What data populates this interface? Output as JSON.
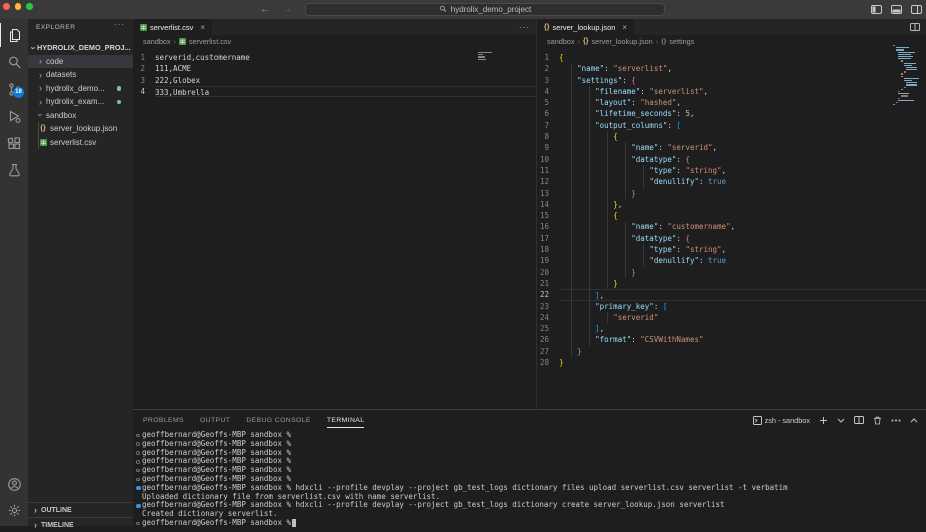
{
  "titlebar": {
    "title": "hydrolix_demo_project",
    "back": "←",
    "forward": "→"
  },
  "activity_bar": {
    "items": [
      {
        "name": "explorer",
        "active": true
      },
      {
        "name": "search"
      },
      {
        "name": "source-control",
        "badge": "18"
      },
      {
        "name": "run-and-debug"
      },
      {
        "name": "extensions"
      },
      {
        "name": "testing"
      }
    ],
    "bottom": [
      {
        "name": "accounts"
      },
      {
        "name": "settings"
      }
    ]
  },
  "sidebar": {
    "title": "EXPLORER",
    "actions_label": "···",
    "root": {
      "label": "HYDROLIX_DEMO_PROJ...",
      "expanded": true
    },
    "items": [
      {
        "label": "code",
        "kind": "folder",
        "selected": true
      },
      {
        "label": "datasets",
        "kind": "folder"
      },
      {
        "label": "hydrolix_demo...",
        "kind": "folder",
        "dot": true
      },
      {
        "label": "hydrolix_exam...",
        "kind": "folder",
        "dot": true
      },
      {
        "label": "sandbox",
        "kind": "folder",
        "expanded": true
      },
      {
        "label": "server_lookup.json",
        "kind": "json",
        "child": true
      },
      {
        "label": "serverlist.csv",
        "kind": "csv",
        "child": true
      }
    ],
    "bottom_sections": [
      {
        "label": "OUTLINE"
      },
      {
        "label": "TIMELINE"
      }
    ]
  },
  "editors": {
    "left": {
      "tab": {
        "label": "serverlist.csv",
        "close": "×"
      },
      "actions_label": "···",
      "breadcrumb": {
        "parts": [
          "sandbox",
          "serverlist.csv"
        ]
      },
      "active_line": 4,
      "lines": [
        {
          "n": 1,
          "tokens": [
            [
              "serverid,customername",
              "t"
            ]
          ]
        },
        {
          "n": 2,
          "tokens": [
            [
              "111,ACME",
              "t"
            ]
          ]
        },
        {
          "n": 3,
          "tokens": [
            [
              "222,Globex",
              "t"
            ]
          ]
        },
        {
          "n": 4,
          "tokens": [
            [
              "333,Umbrella",
              "t"
            ]
          ]
        }
      ]
    },
    "right": {
      "tab": {
        "label": "server_lookup.json",
        "close": "×"
      },
      "breadcrumb": {
        "parts": [
          "sandbox",
          "server_lookup.json",
          "settings"
        ]
      },
      "active_line": 22,
      "lines": [
        {
          "n": 1,
          "tokens": [
            [
              "{",
              "g"
            ]
          ]
        },
        {
          "n": 2,
          "tokens": [
            [
              "    ",
              "w"
            ],
            [
              "\"name\"",
              "k"
            ],
            [
              ": ",
              "p"
            ],
            [
              "\"serverlist\"",
              "s"
            ],
            [
              ",",
              "p"
            ]
          ]
        },
        {
          "n": 3,
          "tokens": [
            [
              "    ",
              "w"
            ],
            [
              "\"settings\"",
              "k"
            ],
            [
              ": ",
              "p"
            ],
            [
              "{",
              "o"
            ]
          ]
        },
        {
          "n": 4,
          "tokens": [
            [
              "        ",
              "w"
            ],
            [
              "\"filename\"",
              "k"
            ],
            [
              ": ",
              "p"
            ],
            [
              "\"serverlist\"",
              "s"
            ],
            [
              ",",
              "p"
            ]
          ]
        },
        {
          "n": 5,
          "tokens": [
            [
              "        ",
              "w"
            ],
            [
              "\"layout\"",
              "k"
            ],
            [
              ": ",
              "p"
            ],
            [
              "\"hashed\"",
              "s"
            ],
            [
              ",",
              "p"
            ]
          ]
        },
        {
          "n": 6,
          "tokens": [
            [
              "        ",
              "w"
            ],
            [
              "\"lifetime_seconds\"",
              "k"
            ],
            [
              ": ",
              "p"
            ],
            [
              "5",
              "n"
            ],
            [
              ",",
              "p"
            ]
          ]
        },
        {
          "n": 7,
          "tokens": [
            [
              "        ",
              "w"
            ],
            [
              "\"output_columns\"",
              "k"
            ],
            [
              ": ",
              "p"
            ],
            [
              "[",
              "u"
            ]
          ]
        },
        {
          "n": 8,
          "tokens": [
            [
              "            ",
              "w"
            ],
            [
              "{",
              "g"
            ]
          ]
        },
        {
          "n": 9,
          "tokens": [
            [
              "                ",
              "w"
            ],
            [
              "\"name\"",
              "k"
            ],
            [
              ": ",
              "p"
            ],
            [
              "\"serverid\"",
              "s"
            ],
            [
              ",",
              "p"
            ]
          ]
        },
        {
          "n": 10,
          "tokens": [
            [
              "                ",
              "w"
            ],
            [
              "\"datatype\"",
              "k"
            ],
            [
              ": ",
              "p"
            ],
            [
              "{",
              "o"
            ]
          ]
        },
        {
          "n": 11,
          "tokens": [
            [
              "                    ",
              "w"
            ],
            [
              "\"type\"",
              "k"
            ],
            [
              ": ",
              "p"
            ],
            [
              "\"string\"",
              "s"
            ],
            [
              ",",
              "p"
            ]
          ]
        },
        {
          "n": 12,
          "tokens": [
            [
              "                    ",
              "w"
            ],
            [
              "\"denullify\"",
              "k"
            ],
            [
              ": ",
              "p"
            ],
            [
              "true",
              "b"
            ]
          ]
        },
        {
          "n": 13,
          "tokens": [
            [
              "                ",
              "w"
            ],
            [
              "}",
              "o"
            ]
          ]
        },
        {
          "n": 14,
          "tokens": [
            [
              "            ",
              "w"
            ],
            [
              "}",
              "g"
            ],
            [
              ",",
              "p"
            ]
          ]
        },
        {
          "n": 15,
          "tokens": [
            [
              "            ",
              "w"
            ],
            [
              "{",
              "g"
            ]
          ]
        },
        {
          "n": 16,
          "tokens": [
            [
              "                ",
              "w"
            ],
            [
              "\"name\"",
              "k"
            ],
            [
              ": ",
              "p"
            ],
            [
              "\"customername\"",
              "s"
            ],
            [
              ",",
              "p"
            ]
          ]
        },
        {
          "n": 17,
          "tokens": [
            [
              "                ",
              "w"
            ],
            [
              "\"datatype\"",
              "k"
            ],
            [
              ": ",
              "p"
            ],
            [
              "{",
              "o"
            ]
          ]
        },
        {
          "n": 18,
          "tokens": [
            [
              "                    ",
              "w"
            ],
            [
              "\"type\"",
              "k"
            ],
            [
              ": ",
              "p"
            ],
            [
              "\"string\"",
              "s"
            ],
            [
              ",",
              "p"
            ]
          ]
        },
        {
          "n": 19,
          "tokens": [
            [
              "                    ",
              "w"
            ],
            [
              "\"denullify\"",
              "k"
            ],
            [
              ": ",
              "p"
            ],
            [
              "true",
              "b"
            ]
          ]
        },
        {
          "n": 20,
          "tokens": [
            [
              "                ",
              "w"
            ],
            [
              "}",
              "o"
            ]
          ]
        },
        {
          "n": 21,
          "tokens": [
            [
              "            ",
              "w"
            ],
            [
              "}",
              "g"
            ]
          ]
        },
        {
          "n": 22,
          "tokens": [
            [
              "        ",
              "w"
            ],
            [
              "]",
              "u"
            ],
            [
              ",",
              "p"
            ]
          ]
        },
        {
          "n": 23,
          "tokens": [
            [
              "        ",
              "w"
            ],
            [
              "\"primary_key\"",
              "k"
            ],
            [
              ": ",
              "p"
            ],
            [
              "[",
              "u"
            ]
          ]
        },
        {
          "n": 24,
          "tokens": [
            [
              "            ",
              "w"
            ],
            [
              "\"serverid\"",
              "s"
            ]
          ]
        },
        {
          "n": 25,
          "tokens": [
            [
              "        ",
              "w"
            ],
            [
              "]",
              "u"
            ],
            [
              ",",
              "p"
            ]
          ]
        },
        {
          "n": 26,
          "tokens": [
            [
              "        ",
              "w"
            ],
            [
              "\"format\"",
              "k"
            ],
            [
              ": ",
              "p"
            ],
            [
              "\"CSVWithNames\"",
              "s"
            ]
          ]
        },
        {
          "n": 27,
          "tokens": [
            [
              "    ",
              "w"
            ],
            [
              "}",
              "o"
            ]
          ]
        },
        {
          "n": 28,
          "tokens": [
            [
              "}",
              "g"
            ]
          ]
        }
      ]
    }
  },
  "panel": {
    "tabs": [
      {
        "label": "PROBLEMS"
      },
      {
        "label": "OUTPUT"
      },
      {
        "label": "DEBUG CONSOLE"
      },
      {
        "label": "TERMINAL",
        "active": true
      }
    ],
    "shell": {
      "label": "zsh - sandbox"
    },
    "terminal": {
      "lines": [
        {
          "deco": "circle",
          "text": "geoffbernard@Geoffs-MBP sandbox %"
        },
        {
          "deco": "circle",
          "text": "geoffbernard@Geoffs-MBP sandbox %"
        },
        {
          "deco": "circle",
          "text": "geoffbernard@Geoffs-MBP sandbox %"
        },
        {
          "deco": "circle",
          "text": "geoffbernard@Geoffs-MBP sandbox %"
        },
        {
          "deco": "circle",
          "text": "geoffbernard@Geoffs-MBP sandbox %"
        },
        {
          "deco": "circle",
          "text": "geoffbernard@Geoffs-MBP sandbox %"
        },
        {
          "deco": "blue",
          "text": "geoffbernard@Geoffs-MBP sandbox % hdxcli --profile devplay --project gb_test_logs dictionary files upload serverlist.csv serverlist -t verbatim"
        },
        {
          "deco": "none",
          "text": "Uploaded dictionary file from serverlist.csv with name serverlist."
        },
        {
          "deco": "blue",
          "text": "geoffbernard@Geoffs-MBP sandbox % hdxcli --profile devplay --project gb_test_logs dictionary create server_lookup.json serverlist"
        },
        {
          "deco": "none",
          "text": "Created dictionary serverlist."
        },
        {
          "deco": "circle",
          "text": "geoffbernard@Geoffs-MBP sandbox %",
          "cursor": true
        }
      ]
    }
  },
  "colors": {
    "badge": "#0e7ad6",
    "git_dot": "#73c991",
    "json_icon": "#d7ba7d",
    "csv_icon": "#4e9a4e",
    "key": "#9cdcfe",
    "string": "#ce9178",
    "number": "#b5cea8",
    "boolean": "#569cd6",
    "bracket_depth1": "#ffd700",
    "bracket_depth2": "#da70d6",
    "bracket_depth3": "#179fff",
    "terminal_command_dot": "#3b8eea"
  }
}
